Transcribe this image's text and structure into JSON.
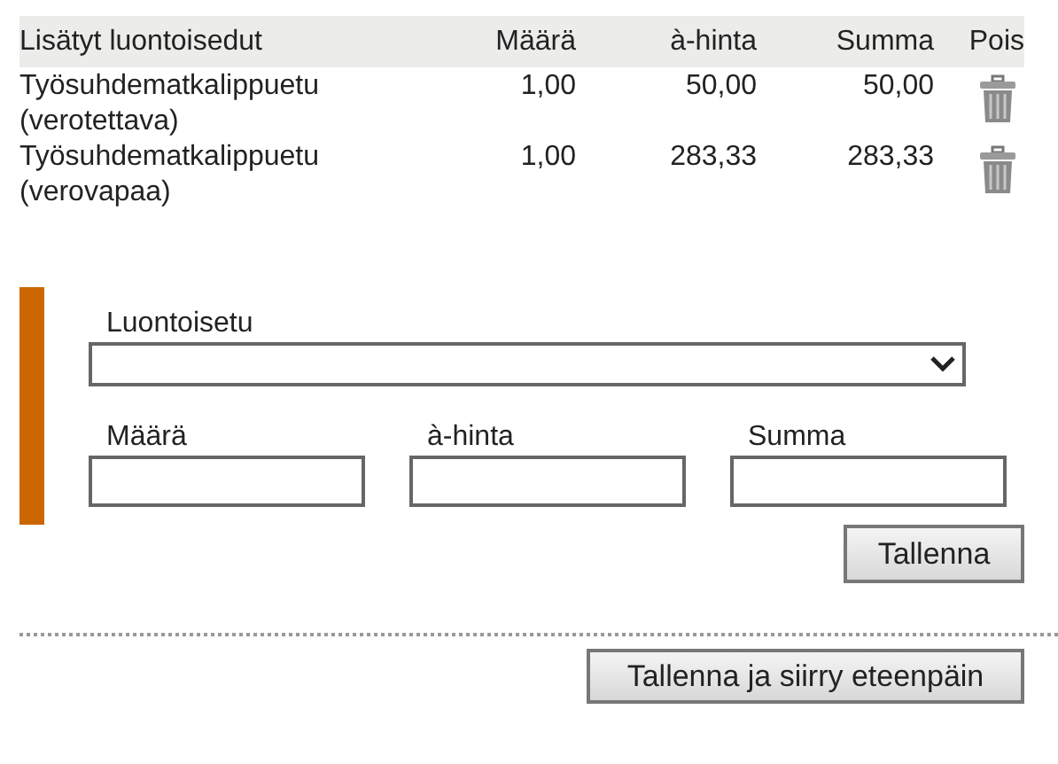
{
  "table": {
    "columns": [
      "Lisätyt luontoisedut",
      "Määrä",
      "à-hinta",
      "Summa",
      "Pois"
    ],
    "rows": [
      {
        "name": [
          "Työsuhdematkalippuetu",
          "(verotettava)"
        ],
        "quantity": "1,00",
        "unit_price": "50,00",
        "sum": "50,00"
      },
      {
        "name": [
          "Työsuhdematkalippuetu",
          "(verovapaa)"
        ],
        "quantity": "1,00",
        "unit_price": "283,33",
        "sum": "283,33"
      }
    ]
  },
  "form": {
    "benefit_label": "Luontoisetu",
    "fields": [
      "Määrä",
      "à-hinta",
      "Summa"
    ],
    "save_button": "Tallenna"
  },
  "continue_button": "Tallenna ja siirry eteenpäin"
}
